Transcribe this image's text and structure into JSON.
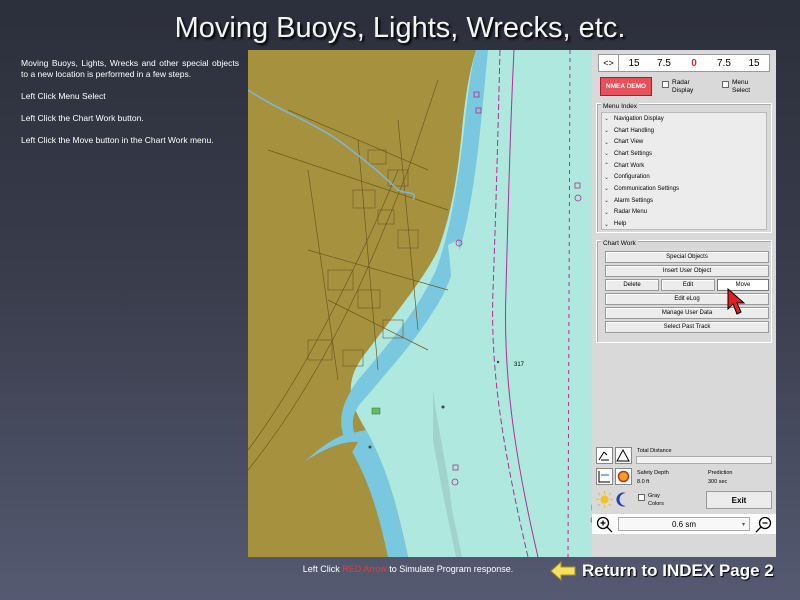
{
  "slide": {
    "title": "Moving Buoys, Lights, Wrecks, etc.",
    "instructions": [
      "Moving Buoys, Lights, Wrecks and other special objects to a new location is performed in a few steps.",
      "Left Click Menu Select",
      "Left Click the Chart Work button.",
      "Left Click the Move button in the Chart Work menu."
    ]
  },
  "chart": {
    "sounding_label": "317",
    "colors": {
      "land": "#a6913f",
      "water": "#aee8df",
      "shallow": "#79c8e0"
    }
  },
  "panel": {
    "scale": {
      "toggle": "<>",
      "values": [
        "15",
        "7.5",
        "0",
        "7.5",
        "15"
      ]
    },
    "nmea_label": "NMEA DEMO",
    "radar_display_label": "Radar Display",
    "menu_select_label": "Menu Select",
    "menu_index": {
      "title": "Menu Index",
      "items": [
        {
          "label": "Navigation Display",
          "chevron": "chevron-down"
        },
        {
          "label": "Chart Handling",
          "chevron": "chevron-down"
        },
        {
          "label": "Chart View",
          "chevron": "chevron-down"
        },
        {
          "label": "Chart Settings",
          "chevron": "chevron-down"
        },
        {
          "label": "Chart Work",
          "chevron": "chevron-up"
        },
        {
          "label": "Configuration",
          "chevron": "chevron-down"
        },
        {
          "label": "Communication Settings",
          "chevron": "chevron-down"
        },
        {
          "label": "Alarm Settings",
          "chevron": "chevron-down"
        },
        {
          "label": "Radar Menu",
          "chevron": "chevron-down"
        },
        {
          "label": "Help",
          "chevron": "chevron-down"
        }
      ]
    },
    "chart_work": {
      "title": "Chart Work",
      "special_objects": "Special Objects",
      "insert_user_object": "Insert User Object",
      "delete": "Delete",
      "edit": "Edit",
      "move": "Move",
      "edit_elog": "Edit eLog",
      "manage_user_data": "Manage User Data",
      "select_past_track": "Select Past Track"
    },
    "bottom": {
      "total_distance_label": "Total Distance",
      "safety_depth_label": "Safety Depth",
      "safety_depth_value": "8.0 ft",
      "prediction_label": "Prediction",
      "prediction_value": "300 sec",
      "gray_colors_label": "Gray Colors",
      "exit_label": "Exit",
      "zoom_value": "0.6 sm"
    }
  },
  "footer": {
    "instruction_prefix": "Left Click ",
    "instruction_highlight": "RED Arrow",
    "instruction_suffix": " to Simulate Program response.",
    "return_label": "Return to INDEX Page 2"
  }
}
